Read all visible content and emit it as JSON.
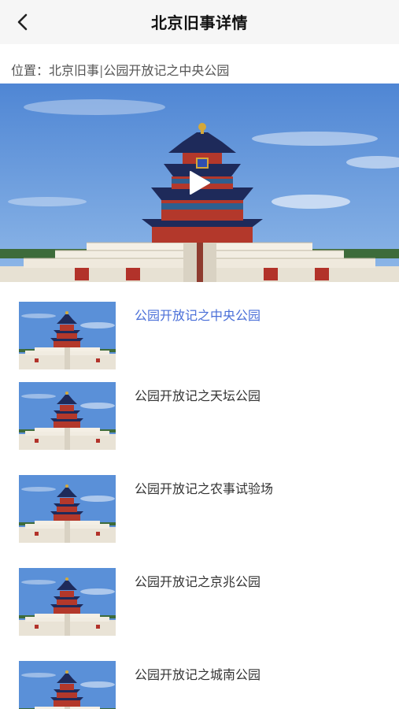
{
  "header": {
    "title": "北京旧事详情",
    "back_icon": "chevron-left-icon"
  },
  "breadcrumb": {
    "prefix": "位置：",
    "section": "北京旧事",
    "separator": "|",
    "current": "公园开放记之中央公园"
  },
  "video": {
    "play_icon": "play-icon",
    "image": "temple-of-heaven-photo"
  },
  "items": [
    {
      "label": "公园开放记之中央公园",
      "active": true
    },
    {
      "label": "公园开放记之天坛公园",
      "active": false
    },
    {
      "label": "公园开放记之农事试验场",
      "active": false
    },
    {
      "label": "公园开放记之京兆公园",
      "active": false
    },
    {
      "label": "公园开放记之城南公园",
      "active": false
    }
  ],
  "colors": {
    "active_text": "#4a6fd8",
    "header_bg": "#f6f6f6",
    "sky": "#5b8fd6"
  }
}
